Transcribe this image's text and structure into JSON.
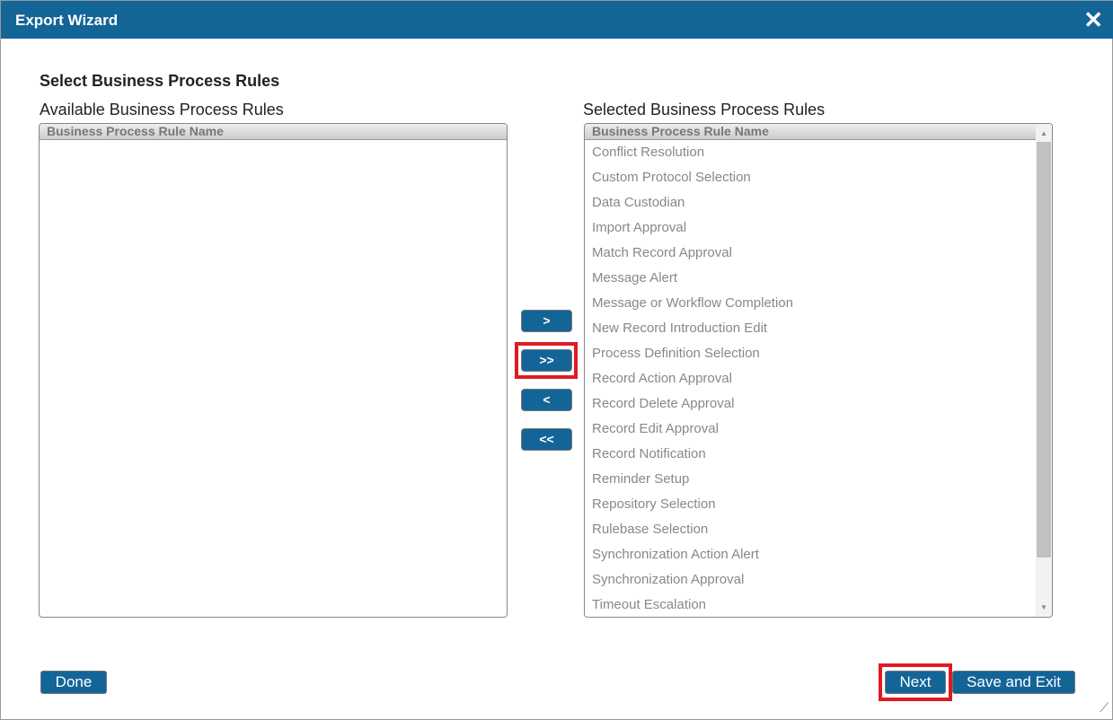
{
  "window": {
    "title": "Export Wizard"
  },
  "heading": "Select Business Process Rules",
  "available": {
    "label": "Available Business Process Rules",
    "column": "Business Process Rule Name",
    "items": []
  },
  "selected": {
    "label": "Selected Business Process Rules",
    "column": "Business Process Rule Name",
    "items": [
      "Conflict Resolution",
      "Custom Protocol Selection",
      "Data Custodian",
      "Import Approval",
      "Match Record Approval",
      "Message Alert",
      "Message or Workflow Completion",
      "New Record Introduction Edit",
      "Process Definition Selection",
      "Record Action Approval",
      "Record Delete Approval",
      "Record Edit Approval",
      "Record Notification",
      "Reminder Setup",
      "Repository Selection",
      "Rulebase Selection",
      "Synchronization Action Alert",
      "Synchronization Approval",
      "Timeout Escalation"
    ]
  },
  "move": {
    "add": ">",
    "add_all": ">>",
    "remove": "<",
    "remove_all": "<<"
  },
  "footer": {
    "done": "Done",
    "next": "Next",
    "save_exit": "Save and Exit"
  }
}
